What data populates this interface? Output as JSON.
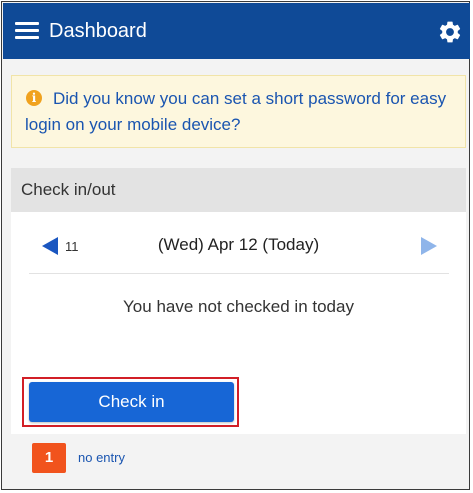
{
  "header": {
    "title": "Dashboard",
    "menu_icon": "hamburger-menu-icon",
    "settings_icon": "gear-icon",
    "background_color": "#0f4a97"
  },
  "info_banner": {
    "icon": "info-icon",
    "icon_glyph": "i",
    "text": "Did you know you can set a short password for easy login on your mobile device?",
    "text_color": "#1a55b0",
    "background_color": "#fdf7de"
  },
  "checkin_card": {
    "title": "Check in/out",
    "prev_day": "11",
    "current_date": "(Wed) Apr 12 (Today)",
    "status_message": "You have not checked in today",
    "checkin_button_label": "Check in",
    "accent_color": "#1766d6",
    "highlight_color": "#d21f26"
  },
  "entries": {
    "count": "1",
    "label": "no entry",
    "badge_color": "#f1531d"
  }
}
